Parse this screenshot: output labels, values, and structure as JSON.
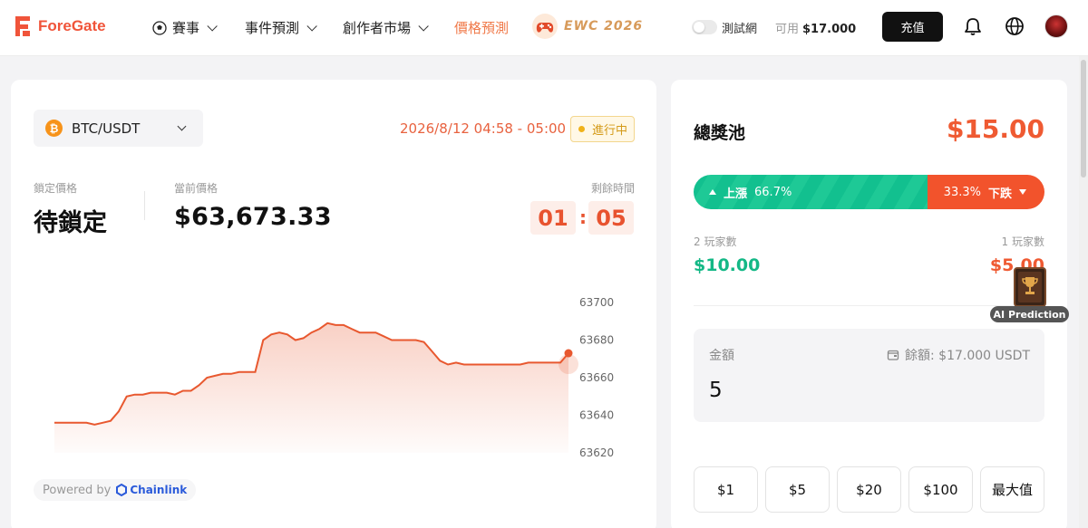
{
  "brand": {
    "name": "ForeGate",
    "color": "#f0543a"
  },
  "nav": {
    "items": [
      {
        "label": "賽事",
        "has_dropdown": true,
        "icon": "soccer-ball-icon"
      },
      {
        "label": "事件預測",
        "has_dropdown": true
      },
      {
        "label": "創作者市場",
        "has_dropdown": true
      },
      {
        "label": "價格預測",
        "active": true
      }
    ],
    "ewc_label": "EWC 2026",
    "testnet_label": "測試網",
    "available_label": "可用",
    "available_value": "$17.000",
    "recharge_label": "充值",
    "icons": [
      "bell-icon",
      "globe-icon",
      "avatar"
    ]
  },
  "market": {
    "pair": "BTC/USDT",
    "pair_icon": "₿",
    "time_range": "2026/8/12 04:58 - 05:00",
    "status": "進行中",
    "locked_label": "鎖定價格",
    "locked_value": "待鎖定",
    "current_label": "當前價格",
    "current_value": "$63,673.33",
    "remaining_label": "剩餘時間",
    "countdown_min": "01",
    "countdown_sep": ":",
    "countdown_sec": "05",
    "powered_by": "Powered by",
    "oracle": "Chainlink"
  },
  "chart_data": {
    "type": "area",
    "color": "#e8582f",
    "yticks": [
      63700,
      63680,
      63660,
      63640,
      63620
    ],
    "ylim": [
      63620,
      63700
    ],
    "values": [
      63636,
      63636,
      63636,
      63636,
      63636,
      63635,
      63636,
      63637,
      63642,
      63650,
      63651,
      63651,
      63652,
      63652,
      63652,
      63651,
      63653,
      63653,
      63656,
      63660,
      63661,
      63662,
      63662,
      63663,
      63663,
      63663,
      63680,
      63683,
      63684,
      63683,
      63680,
      63681,
      63684,
      63686,
      63689,
      63688,
      63688,
      63686,
      63684,
      63684,
      63684,
      63682,
      63680,
      63680,
      63680,
      63680,
      63679,
      63674,
      63669,
      63667,
      63668,
      63667,
      63667,
      63667,
      63667,
      63667,
      63667,
      63667,
      63667,
      63668,
      63668,
      63668,
      63668,
      63668,
      63673
    ]
  },
  "pool": {
    "title": "總獎池",
    "value": "$15.00",
    "up_label": "上漲",
    "up_pct": "66.7%",
    "down_label": "下跌",
    "down_pct": "33.3%",
    "up_color": "#14c18e",
    "down_color": "#f2532c",
    "up_players": "2 玩家數",
    "down_players": "1 玩家數",
    "up_amount": "$10.00",
    "down_amount": "$5.00",
    "ai_label": "AI Prediction"
  },
  "bet": {
    "amount_label": "金額",
    "balance_label": "餘額: $17.000 USDT",
    "amount_value": "5",
    "quick_amounts": [
      "$1",
      "$5",
      "$20",
      "$100",
      "最大值"
    ]
  }
}
